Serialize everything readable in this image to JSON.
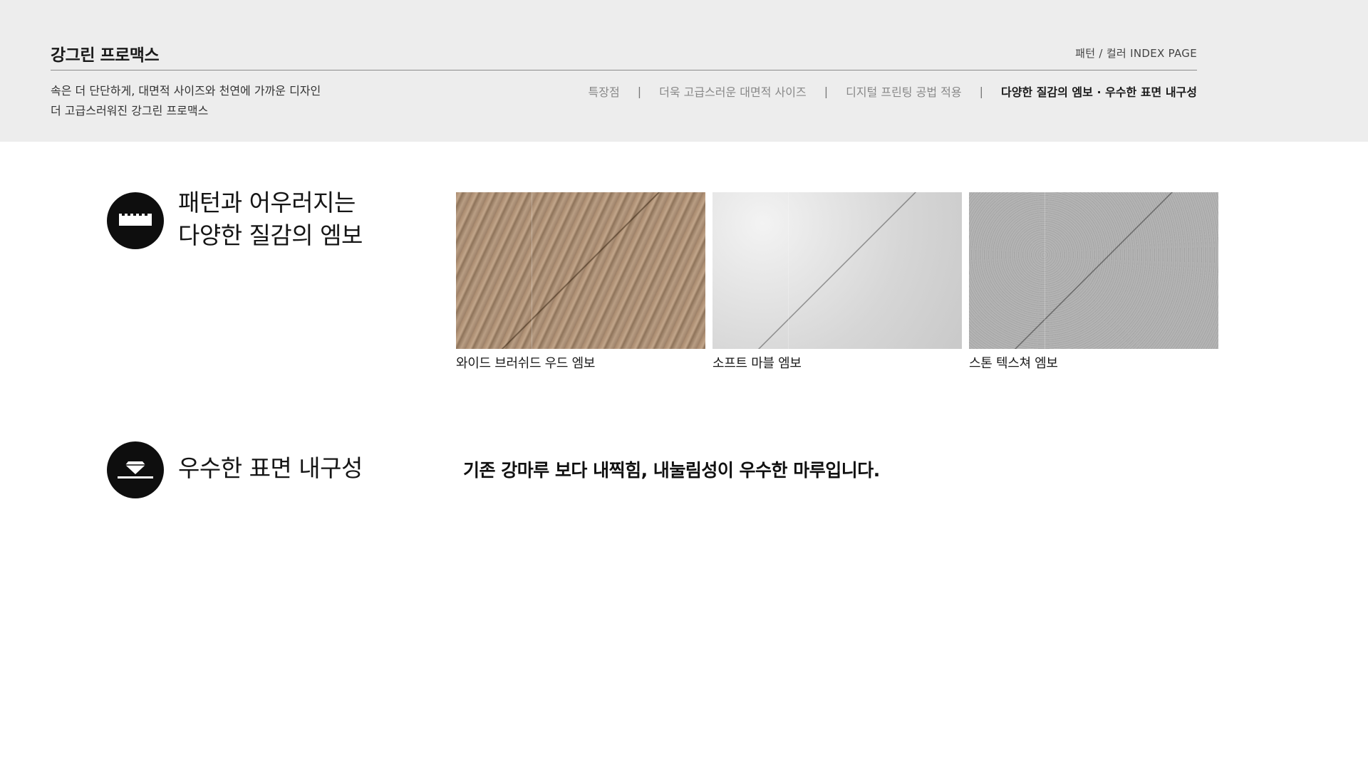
{
  "header": {
    "brand": "강그린 프로맥스",
    "index_label": "패턴 / 컬러 INDEX PAGE",
    "tagline": [
      "속은 더 단단하게, 대면적 사이즈와 천연에 가까운 디자인",
      "더 고급스러워진 강그린 프로맥스"
    ],
    "nav": [
      {
        "label": "특장점",
        "active": false
      },
      {
        "label": "더욱 고급스러운 대면적 사이즈",
        "active": false
      },
      {
        "label": "디지털 프린팅 공법 적용",
        "active": false
      },
      {
        "label": "다양한 질감의 엠보 · 우수한 표면 내구성",
        "active": true
      }
    ],
    "separator": "|"
  },
  "features": {
    "emboss": {
      "icon": "emboss-texture-icon",
      "title": [
        "패턴과 어우러지는",
        "다양한 질감의 엠보"
      ],
      "swatches": [
        {
          "caption": "와이드 브러쉬드 우드 엠보",
          "texture": "wood"
        },
        {
          "caption": "소프트 마블 엠보",
          "texture": "marble"
        },
        {
          "caption": "스톤 텍스쳐 엠보",
          "texture": "stone"
        }
      ]
    },
    "durability": {
      "icon": "diamond-surface-icon",
      "title": "우수한 표면 내구성",
      "description": "기존 강마루 보다 내찍힘, 내눌림성이 우수한 마루입니다."
    }
  },
  "colors": {
    "header_bg": "#ededed",
    "icon_bg": "#0e0e0e"
  }
}
